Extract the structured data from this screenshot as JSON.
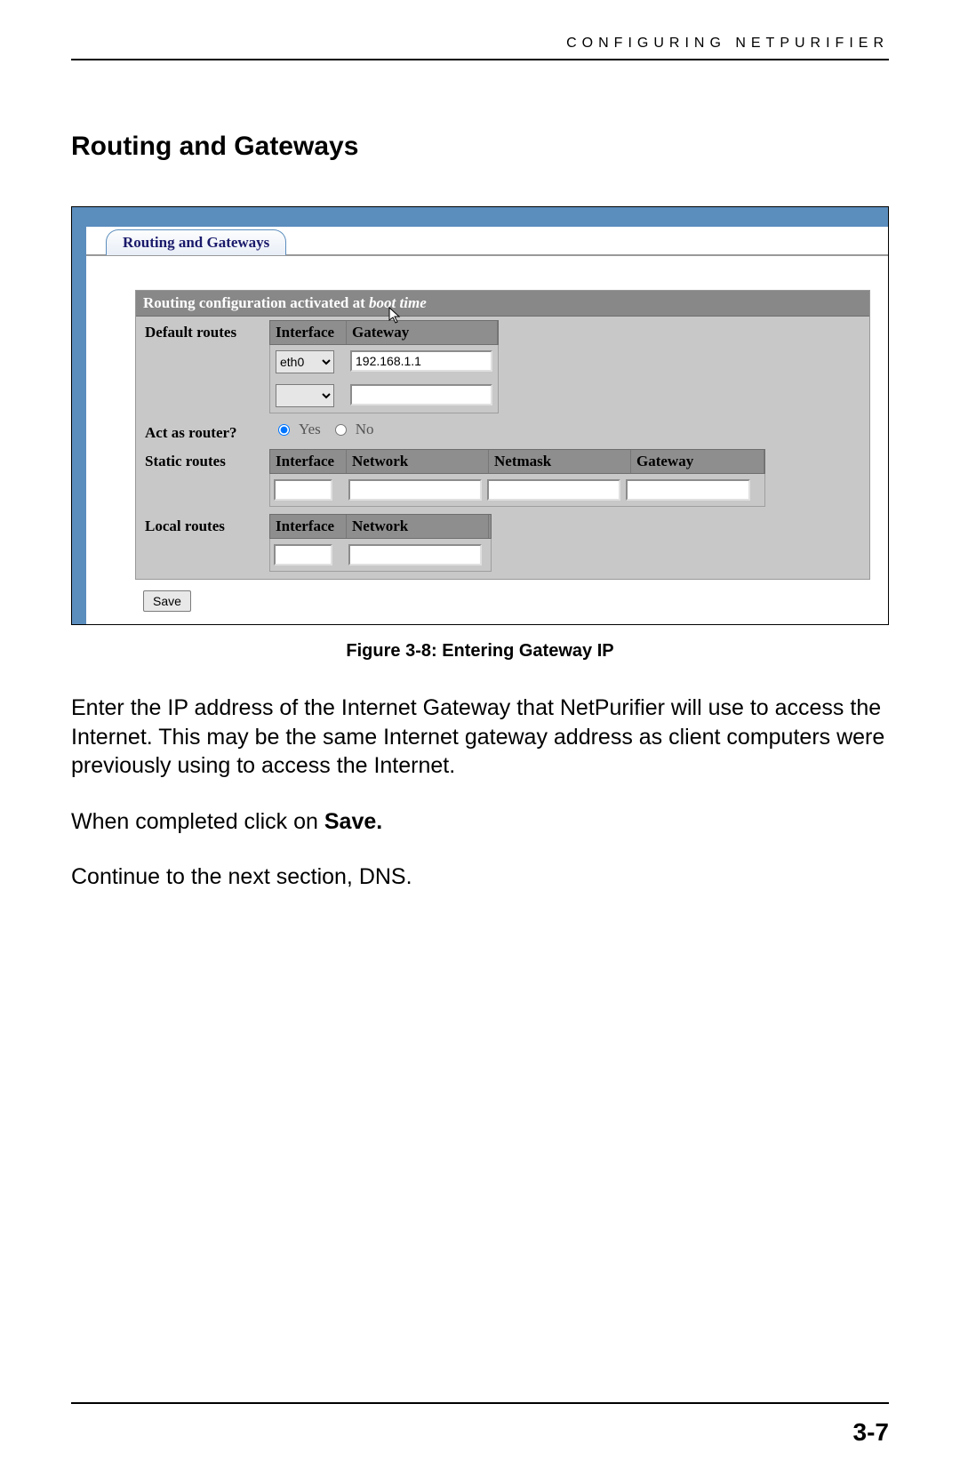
{
  "header": {
    "chapter": "CONFIGURING NETPURIFIER"
  },
  "section": {
    "title": "Routing and Gateways"
  },
  "screenshot": {
    "tab_label": "Routing and Gateways",
    "config_header_prefix": "Routing configuration activated at ",
    "config_header_em": "boot time",
    "rows": {
      "default_routes_label": "Default routes",
      "act_as_router_label": "Act as router?",
      "static_routes_label": "Static routes",
      "local_routes_label": "Local routes"
    },
    "columns": {
      "interface": "Interface",
      "gateway": "Gateway",
      "network": "Network",
      "netmask": "Netmask"
    },
    "default_routes": {
      "interface_selected": "eth0",
      "gateway_value": "192.168.1.1"
    },
    "router_options": {
      "yes": "Yes",
      "no": "No"
    },
    "save_button": "Save"
  },
  "figure_caption": "Figure 3-8: Entering Gateway IP",
  "paragraphs": {
    "p1": "Enter the IP address of the Internet Gateway that NetPurifier will use to access the Internet. This may be the same Internet gateway address as client computers were previously using to access the Internet.",
    "p2_prefix": "When completed click on ",
    "p2_bold": "Save.",
    "p3": "Continue to the next section, DNS."
  },
  "page_number": "3-7"
}
